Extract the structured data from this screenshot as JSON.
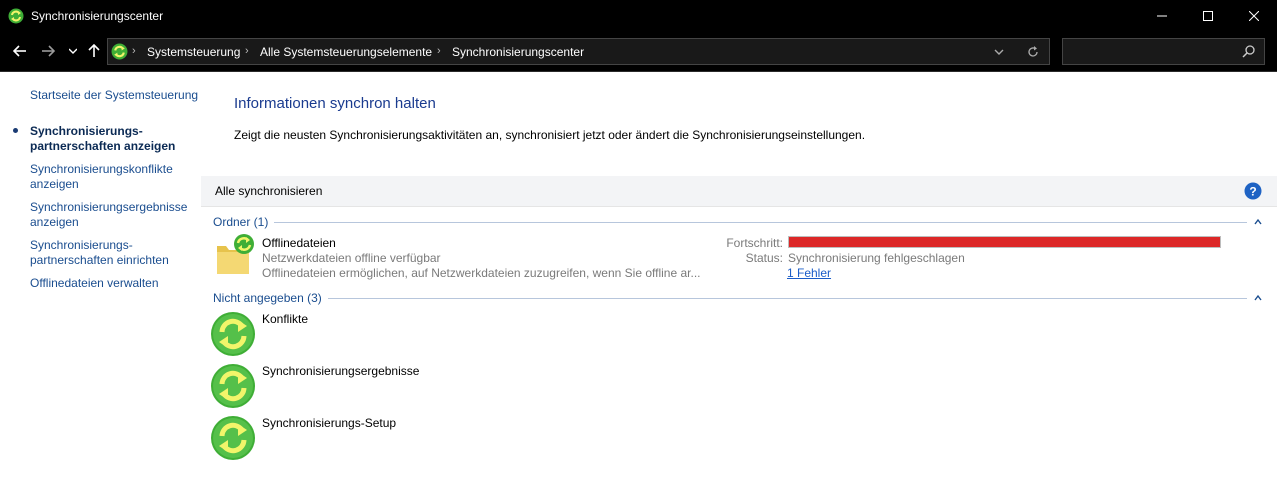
{
  "window": {
    "title": "Synchronisierungscenter"
  },
  "address": {
    "crumbs": [
      "Systemsteuerung",
      "Alle Systemsteuerungselemente",
      "Synchronisierungscenter"
    ],
    "search_placeholder": ""
  },
  "sidebar": {
    "items": [
      {
        "label": "Startseite der Systemsteuerung"
      },
      {
        "label": "Synchronisierungs-partnerschaften anzeigen"
      },
      {
        "label": "Synchronisierungskonflikte anzeigen"
      },
      {
        "label": "Synchronisierungsergebnisse anzeigen"
      },
      {
        "label": "Synchronisierungs-partnerschaften einrichten"
      },
      {
        "label": "Offlinedateien verwalten"
      }
    ]
  },
  "main": {
    "title": "Informationen synchron halten",
    "description": "Zeigt die neusten Synchronisierungsaktivitäten an, synchronisiert jetzt oder ändert die Synchronisierungseinstellungen.",
    "toolbar": {
      "sync_all": "Alle synchronisieren"
    },
    "groups": [
      {
        "header": "Ordner (1)",
        "items": [
          {
            "name": "Offlinedateien",
            "line1": "Netzwerkdateien offline verfügbar",
            "line2": "Offlinedateien ermöglichen, auf Netzwerkdateien zuzugreifen, wenn Sie offline ar...",
            "progress_label": "Fortschritt:",
            "progress_value": 1.0,
            "status_label": "Status:",
            "status_value": "Synchronisierung fehlgeschlagen",
            "error_link": "1 Fehler"
          }
        ]
      },
      {
        "header": "Nicht angegeben (3)",
        "items": [
          {
            "name": "Konflikte"
          },
          {
            "name": "Synchronisierungsergebnisse"
          },
          {
            "name": "Synchronisierungs-Setup"
          }
        ]
      }
    ]
  },
  "colors": {
    "progress_fill": "#dc2727",
    "link": "#1a5cc8",
    "sync_green": "#3fae36"
  }
}
